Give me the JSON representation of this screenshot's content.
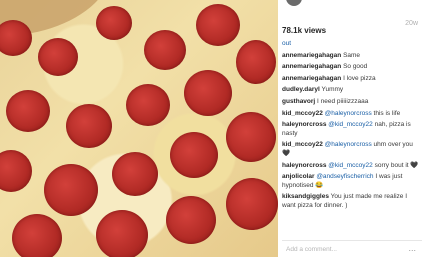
{
  "post": {
    "views": "78.1k views",
    "age": "20w"
  },
  "comments": {
    "load_more": "out",
    "items": [
      {
        "user": "annemariegahagan",
        "text": "Same"
      },
      {
        "user": "annemariegahagan",
        "text": "So good"
      },
      {
        "user": "annemariegahagan",
        "text": "I love pizza"
      },
      {
        "user": "dudley.daryl",
        "text": "Yummy"
      },
      {
        "user": "gusthavorj",
        "text": "I need piiiiizzzaaa"
      },
      {
        "user": "kid_mccoy22",
        "mention": "@haleynorcross",
        "text": "this is life"
      },
      {
        "user": "haleynorcross",
        "mention": "@kid_mccoy22",
        "text": "nah, pizza is nasty"
      },
      {
        "user": "kid_mccoy22",
        "mention": "@haleynorcross",
        "text": "uhm over you 🖤"
      },
      {
        "user": "haleynorcross",
        "mention": "@kid_mccoy22",
        "text": "sorry bout it 🖤"
      },
      {
        "user": "anjolicolar",
        "mention": "@andseyfischerrich",
        "text": "I was just hypnotised 😂"
      },
      {
        "user": "kiksandgiggles",
        "text": "You just made me realize I want pizza for dinner. )"
      }
    ]
  },
  "add_comment": {
    "placeholder": "Add a comment...",
    "more_label": "..."
  }
}
